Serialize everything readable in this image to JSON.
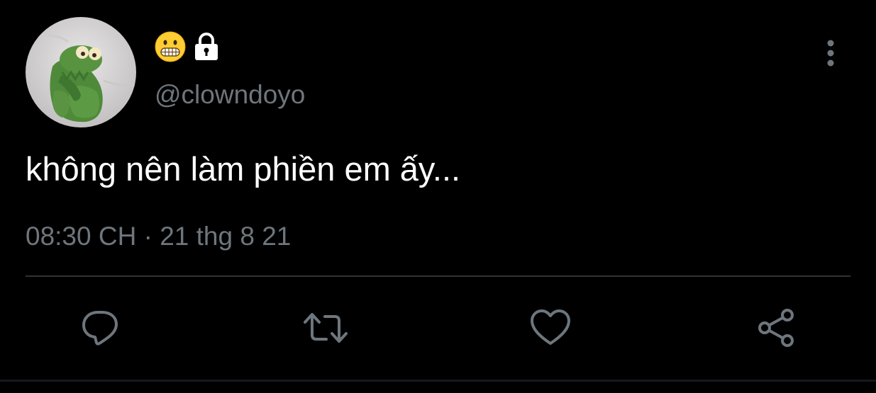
{
  "colors": {
    "background": "#000000",
    "text_primary": "#ffffff",
    "text_secondary": "#6e767d",
    "divider": "#2f3336",
    "icon": "#6e767d"
  },
  "profile": {
    "avatar": "kermit-frog-avatar",
    "name_icons": [
      "grimacing-face-emoji",
      "lock-icon"
    ],
    "handle": "@clowndoyo"
  },
  "tweet": {
    "text": "không nên làm phiền em ấy...",
    "timestamp": "08:30 CH · 21 thg 8 21"
  },
  "menu": {
    "icon": "more-vertical-icon"
  },
  "actions": [
    {
      "name": "reply",
      "icon": "reply-icon"
    },
    {
      "name": "retweet",
      "icon": "retweet-icon"
    },
    {
      "name": "like",
      "icon": "heart-icon"
    },
    {
      "name": "share",
      "icon": "share-icon"
    }
  ]
}
